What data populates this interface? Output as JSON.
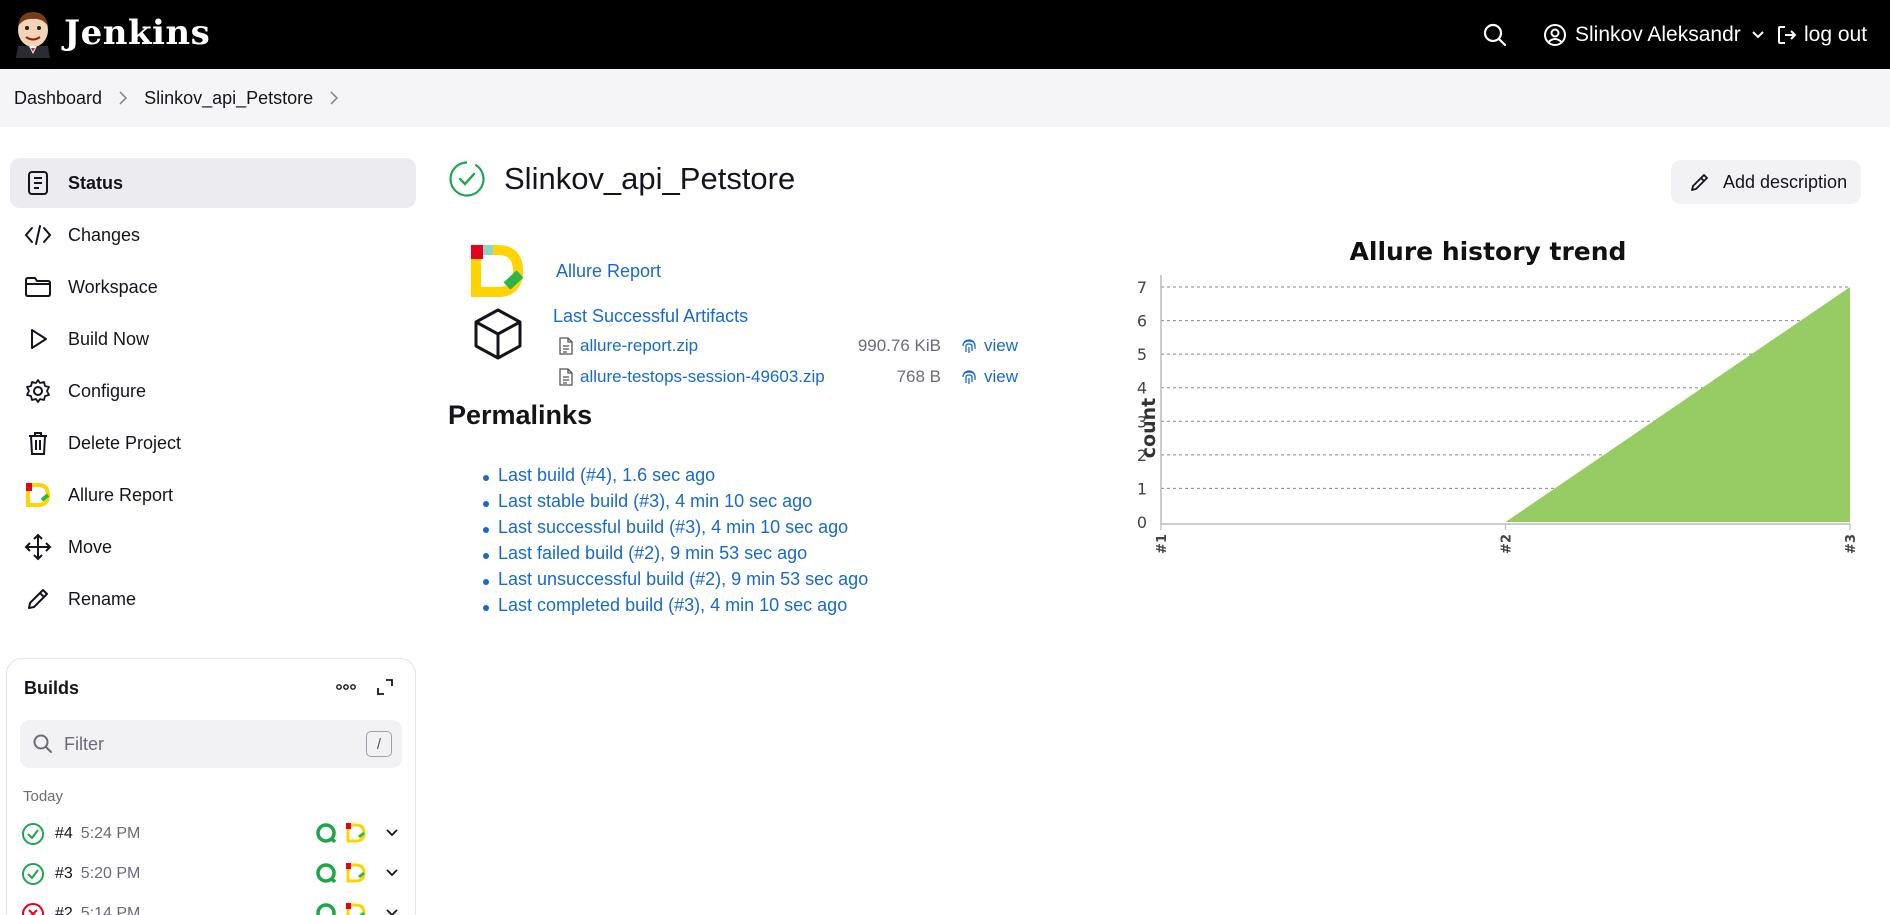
{
  "header": {
    "brand": "Jenkins",
    "user_name": "Slinkov Aleksandr",
    "logout_label": "log out"
  },
  "breadcrumb": [
    "Dashboard",
    "Slinkov_api_Petstore"
  ],
  "sidebar": {
    "items": [
      {
        "label": "Status",
        "icon": "status-icon",
        "active": true
      },
      {
        "label": "Changes",
        "icon": "code-icon"
      },
      {
        "label": "Workspace",
        "icon": "folder-icon"
      },
      {
        "label": "Build Now",
        "icon": "play-icon"
      },
      {
        "label": "Configure",
        "icon": "gear-icon"
      },
      {
        "label": "Delete Project",
        "icon": "trash-icon"
      },
      {
        "label": "Allure Report",
        "icon": "allure-icon"
      },
      {
        "label": "Move",
        "icon": "move-icon"
      },
      {
        "label": "Rename",
        "icon": "pencil-icon"
      }
    ]
  },
  "builds": {
    "title": "Builds",
    "filter_placeholder": "Filter",
    "filter_shortcut": "/",
    "group_label": "Today",
    "rows": [
      {
        "number": "#4",
        "time": "5:24 PM",
        "status": "success"
      },
      {
        "number": "#3",
        "time": "5:20 PM",
        "status": "success"
      },
      {
        "number": "#2",
        "time": "5:14 PM",
        "status": "failed"
      }
    ]
  },
  "main": {
    "title": "Slinkov_api_Petstore",
    "add_description_label": "Add description",
    "allure_link": "Allure Report",
    "artifacts_title": "Last Successful Artifacts",
    "artifacts": [
      {
        "name": "allure-report.zip",
        "size": "990.76 KiB",
        "view": "view"
      },
      {
        "name": "allure-testops-session-49603.zip",
        "size": "768 B",
        "view": "view"
      }
    ],
    "permalinks_title": "Permalinks",
    "permalinks": [
      "Last build (#4), 1.6 sec ago",
      "Last stable build (#3), 4 min 10 sec ago",
      "Last successful build (#3), 4 min 10 sec ago",
      "Last failed build (#2), 9 min 53 sec ago",
      "Last unsuccessful build (#2), 9 min 53 sec ago",
      "Last completed build (#3), 4 min 10 sec ago"
    ]
  },
  "colors": {
    "accent": "#1669d3",
    "success": "#1ea64b",
    "failed": "#e6001f",
    "area": "#97cc64"
  },
  "chart_data": {
    "type": "area",
    "title": "Allure history trend",
    "ylabel": "count",
    "xlabel": "",
    "x": [
      "#1",
      "#2",
      "#3"
    ],
    "series": [
      {
        "values": [
          0,
          0,
          7
        ]
      }
    ],
    "ylim": [
      0,
      7
    ],
    "yticks": [
      0,
      1,
      2,
      3,
      4,
      5,
      6,
      7
    ],
    "grid": true
  }
}
